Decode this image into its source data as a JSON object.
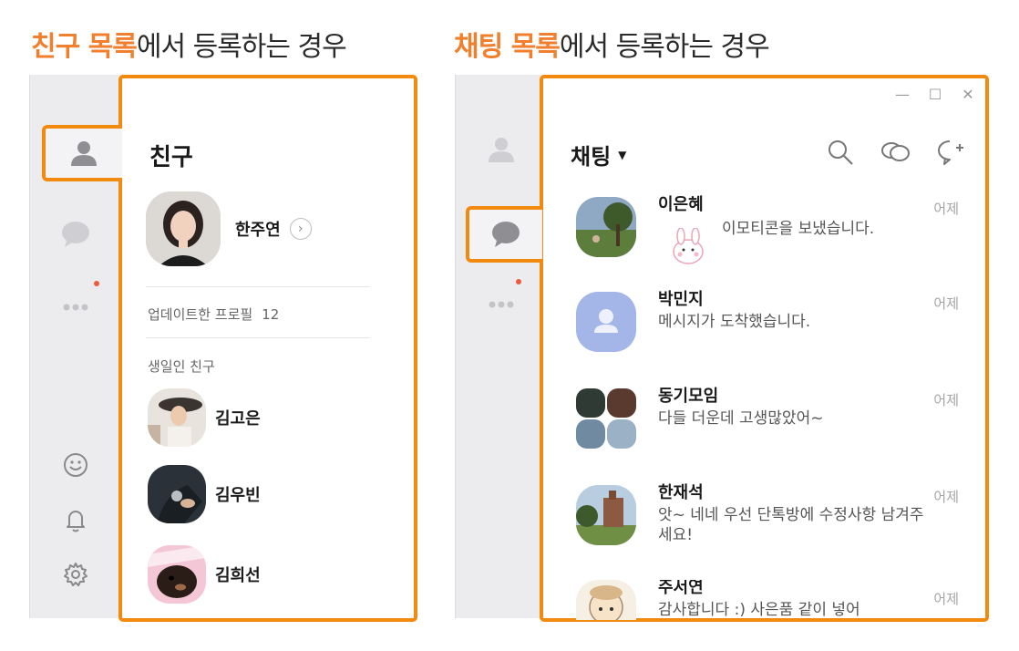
{
  "headings": {
    "left": {
      "highlight": "친구 목록",
      "rest": "에서 등록하는 경우"
    },
    "right": {
      "highlight": "채팅 목록",
      "rest": "에서 등록하는 경우"
    }
  },
  "colors": {
    "accent": "#f28a10",
    "heading_highlight": "#f07f2e",
    "notification_dot": "#f05a3c"
  },
  "sidebar_icons": [
    "person-icon",
    "chat-bubble-icon",
    "more-icon",
    "emoji-icon",
    "bell-icon",
    "gear-icon"
  ],
  "friends_panel": {
    "title": "친구",
    "my_profile": {
      "name": "한주연"
    },
    "updated_profiles": {
      "label": "업데이트한 프로필",
      "count": "12"
    },
    "birthday_section": {
      "label": "생일인 친구"
    },
    "friends": [
      {
        "name": "김고은"
      },
      {
        "name": "김우빈"
      },
      {
        "name": "김희선"
      }
    ]
  },
  "chats_panel": {
    "title": "채팅",
    "window_controls": [
      "minimize",
      "maximize",
      "close"
    ],
    "chats": [
      {
        "name": "이은혜",
        "message": "이모티콘을 보냈습니다.",
        "time": "어제"
      },
      {
        "name": "박민지",
        "message": "메시지가 도착했습니다.",
        "time": "어제"
      },
      {
        "name": "동기모임",
        "message": "다들 더운데 고생많았어~",
        "time": "어제"
      },
      {
        "name": "한재석",
        "message": "앗~ 네네 우선 단톡방에 수정사항 남겨주세요!",
        "time": "어제"
      },
      {
        "name": "주서연",
        "message": "감사합니다 :) 사은품 같이 넣어",
        "time": "어제"
      }
    ]
  }
}
